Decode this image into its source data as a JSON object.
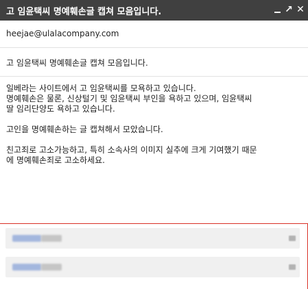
{
  "window": {
    "title": "고 임윤택씨 명예훼손글 캡쳐 모음입니다.",
    "controls": {
      "minimize_icon": "minimize-icon",
      "popout_icon": "popout-icon",
      "close_icon": "close-icon",
      "popout_glyph": "↗",
      "close_glyph": "✕"
    }
  },
  "compose": {
    "to": "heejae@ulalacompany.com",
    "subject": "고 임윤택씨 명예훼손글 캡쳐 모음입니다.",
    "body": [
      "일베라는 사이트에서 고 임윤택씨를 모욕하고 있습니다.\n명예훼손은 물론, 신상털기 및 임윤택씨 부인을 욕하고 있으며, 임윤택씨\n딸 임리단양도 욕하고 있습니다.",
      "고인을 명예훼손하는 글 캡쳐해서 모았습니다.",
      "친고죄로 고소가능하고, 특히 소속사의 이미지 실추에 크게 기여했기 때문\n에 명예훼손죄로 고소하세요."
    ]
  },
  "attachments": {
    "items": [
      {
        "name": "",
        "size": "",
        "blurred": true
      },
      {
        "name": "",
        "size": "",
        "blurred": true
      }
    ]
  },
  "colors": {
    "titlebar_bg": "#404040",
    "focus_border": "#d93025"
  }
}
